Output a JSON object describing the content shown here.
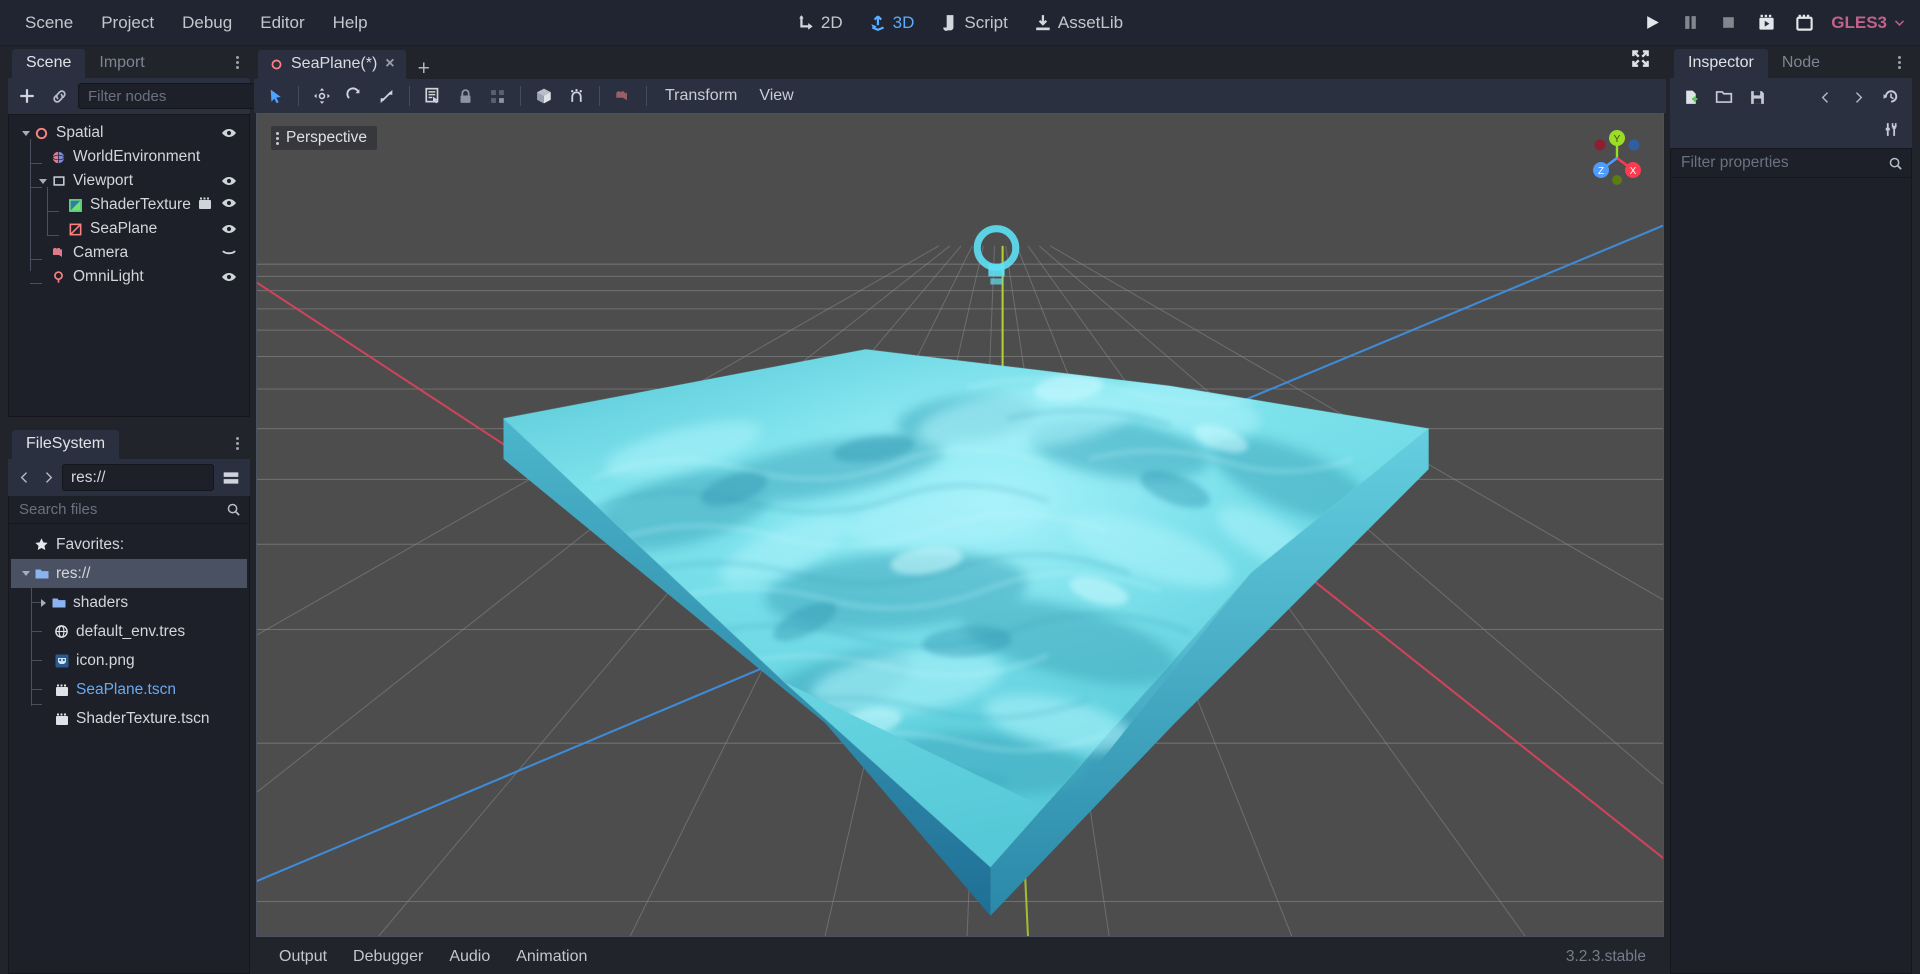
{
  "app": {
    "version": "3.2.3.stable",
    "renderer": "GLES3",
    "accent": "#5badff",
    "panel_bg": "#21242b",
    "tab_bg": "#2a3040",
    "tree_bg": "#1d2028",
    "viewport_bg": "#4d4d4d",
    "renderer_color": "#c0628a",
    "water_color": "#5fd3e0"
  },
  "menubar": {
    "items": [
      {
        "label": "Scene"
      },
      {
        "label": "Project"
      },
      {
        "label": "Debug"
      },
      {
        "label": "Editor"
      },
      {
        "label": "Help"
      }
    ],
    "modes": [
      {
        "label": "2D",
        "icon": "2d-icon",
        "active": false
      },
      {
        "label": "3D",
        "icon": "3d-icon",
        "active": true
      },
      {
        "label": "Script",
        "icon": "script-icon",
        "active": false
      },
      {
        "label": "AssetLib",
        "icon": "assetlib-icon",
        "active": false
      }
    ],
    "playback": [
      {
        "name": "play-button",
        "icon": "play-icon"
      },
      {
        "name": "pause-button",
        "icon": "pause-icon"
      },
      {
        "name": "stop-button",
        "icon": "stop-icon"
      },
      {
        "name": "play-scene-button",
        "icon": "play-scene-icon"
      },
      {
        "name": "play-custom-scene-button",
        "icon": "play-custom-icon"
      }
    ]
  },
  "scene_dock": {
    "tabs": [
      {
        "label": "Scene",
        "active": true
      },
      {
        "label": "Import",
        "active": false
      }
    ],
    "toolbar": {
      "add_node_tooltip": "Add Child Node",
      "link_tooltip": "Instance Child Scene"
    },
    "filter": {
      "placeholder": "Filter nodes",
      "value": ""
    },
    "tree": [
      {
        "label": "Spatial",
        "icon": "spatial-icon",
        "depth": 0,
        "arrow": "down",
        "visibility": "eye"
      },
      {
        "label": "WorldEnvironment",
        "icon": "world-env-icon",
        "depth": 1,
        "arrow": "none",
        "visibility": "none"
      },
      {
        "label": "Viewport",
        "icon": "viewport-icon",
        "depth": 1,
        "arrow": "down",
        "visibility": "eye"
      },
      {
        "label": "ShaderTexture",
        "icon": "shader-texture-icon",
        "depth": 2,
        "arrow": "none",
        "visibility": "eye",
        "extra": "scene-icon"
      },
      {
        "label": "SeaPlane",
        "icon": "mesh-instance-icon",
        "depth": 2,
        "arrow": "none",
        "visibility": "eye"
      },
      {
        "label": "Camera",
        "icon": "camera-icon",
        "depth": 1,
        "arrow": "none",
        "visibility": "chevron"
      },
      {
        "label": "OmniLight",
        "icon": "omnilight-icon",
        "depth": 1,
        "arrow": "none",
        "visibility": "eye"
      }
    ]
  },
  "filesystem_dock": {
    "title": "FileSystem",
    "path": {
      "value": "res://"
    },
    "nav": {
      "back": "‹",
      "forward": "›"
    },
    "search": {
      "placeholder": "Search files",
      "value": ""
    },
    "toggle_split_tooltip": "Toggle Split Mode",
    "tree": [
      {
        "label": "Favorites:",
        "icon": "star-icon",
        "depth": 0,
        "arrow": "none",
        "selected": false,
        "link": false
      },
      {
        "label": "res://",
        "icon": "folder-icon",
        "depth": 0,
        "arrow": "down",
        "selected": true,
        "link": false
      },
      {
        "label": "shaders",
        "icon": "folder-icon",
        "depth": 1,
        "arrow": "right",
        "selected": false,
        "link": false
      },
      {
        "label": "default_env.tres",
        "icon": "env-icon",
        "depth": 1,
        "arrow": "none",
        "selected": false,
        "link": false
      },
      {
        "label": "icon.png",
        "icon": "godot-png-icon",
        "depth": 1,
        "arrow": "none",
        "selected": false,
        "link": false
      },
      {
        "label": "SeaPlane.tscn",
        "icon": "scene-icon",
        "depth": 1,
        "arrow": "none",
        "selected": false,
        "link": true
      },
      {
        "label": "ShaderTexture.tscn",
        "icon": "scene-icon",
        "depth": 1,
        "arrow": "none",
        "selected": false,
        "link": false
      }
    ]
  },
  "editor_tabs": {
    "scene_tab": {
      "label": "SeaPlane(*)",
      "icon": "spatial-icon",
      "close": "×"
    },
    "add_tab": "+",
    "expand_tooltip": "Toggle distraction-free mode"
  },
  "viewport_toolbar": {
    "tools": [
      {
        "name": "select-mode-button",
        "icon": "cursor-icon",
        "active": true
      },
      {
        "name": "move-mode-button",
        "icon": "move-icon",
        "active": false
      },
      {
        "name": "rotate-mode-button",
        "icon": "rotate-icon",
        "active": false
      },
      {
        "name": "scale-mode-button",
        "icon": "scale-icon",
        "active": false
      },
      {
        "name": "list-select-button",
        "icon": "list-select-icon",
        "active": false
      },
      {
        "name": "lock-button",
        "icon": "lock-icon",
        "active": false
      },
      {
        "name": "group-button",
        "icon": "group-icon",
        "active": false
      },
      {
        "name": "local-space-button",
        "icon": "local-space-icon",
        "active": false
      },
      {
        "name": "snap-button",
        "icon": "snap-icon",
        "active": false
      },
      {
        "name": "camera-preview-button",
        "icon": "camera-icon",
        "active": false
      }
    ],
    "menus": [
      {
        "label": "Transform"
      },
      {
        "label": "View"
      }
    ]
  },
  "viewport": {
    "projection_label": "Perspective",
    "gizmo": {
      "axes": [
        {
          "label": "X",
          "color": "#fc3a50"
        },
        {
          "label": "Y",
          "color": "#9bdc27"
        },
        {
          "label": "Z",
          "color": "#4f9cff"
        }
      ]
    },
    "scene_objects": [
      {
        "name": "sea-plane-mesh",
        "type": "MeshInstance"
      },
      {
        "name": "omni-light-gizmo",
        "type": "OmniLight"
      },
      {
        "name": "grid-floor",
        "type": "Grid"
      }
    ]
  },
  "bottom_panel": {
    "items": [
      {
        "label": "Output"
      },
      {
        "label": "Debugger"
      },
      {
        "label": "Audio"
      },
      {
        "label": "Animation"
      }
    ]
  },
  "inspector_dock": {
    "tabs": [
      {
        "label": "Inspector",
        "active": true
      },
      {
        "label": "Node",
        "active": false
      }
    ],
    "toolbar": [
      {
        "name": "new-resource-button",
        "icon": "new-resource-icon"
      },
      {
        "name": "load-resource-button",
        "icon": "folder-open-icon"
      },
      {
        "name": "save-resource-button",
        "icon": "save-icon"
      },
      {
        "name": "history-back-button",
        "icon": "chevron-left-icon"
      },
      {
        "name": "history-forward-button",
        "icon": "chevron-right-icon"
      },
      {
        "name": "history-button",
        "icon": "history-icon"
      },
      {
        "name": "object-menu-button",
        "icon": "tools-icon"
      }
    ],
    "filter": {
      "placeholder": "Filter properties",
      "value": ""
    },
    "properties": []
  }
}
